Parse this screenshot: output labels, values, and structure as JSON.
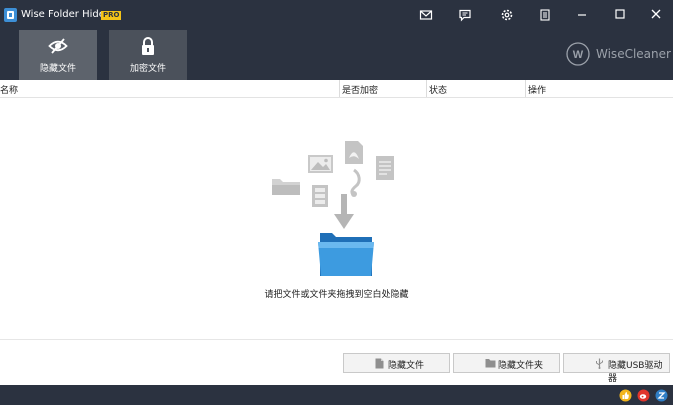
{
  "app": {
    "title": "Wise Folder Hider",
    "badge": "PRO"
  },
  "titlebar": {
    "icons": [
      "mail-icon",
      "message-icon",
      "gear-icon",
      "menu-icon"
    ],
    "window_buttons": [
      "minimize",
      "maximize",
      "close"
    ]
  },
  "tabs": [
    {
      "label": "隐藏文件",
      "icon": "eye-slash-icon",
      "active": true
    },
    {
      "label": "加密文件",
      "icon": "lock-icon",
      "active": false
    }
  ],
  "brand": {
    "logo_letter": "W",
    "name": "WiseCleaner"
  },
  "columns": [
    "名称",
    "是否加密",
    "状态",
    "操作"
  ],
  "drop_hint": "请把文件或文件夹拖拽到空白处隐藏",
  "buttons": [
    {
      "label": "隐藏文件",
      "icon": "file-icon"
    },
    {
      "label": "隐藏文件夹",
      "icon": "folder-icon"
    },
    {
      "label": "隐藏USB驱动器",
      "icon": "usb-icon"
    }
  ],
  "status_icons": [
    "like-icon",
    "weibo-icon",
    "social-icon"
  ],
  "colors": {
    "titlebar_bg": "#2b3240",
    "tab_bg": "#4b515b",
    "tab_active_bg": "#5d636c",
    "pro_badge": "#f3c318",
    "folder_blue": "#3d9be0"
  }
}
